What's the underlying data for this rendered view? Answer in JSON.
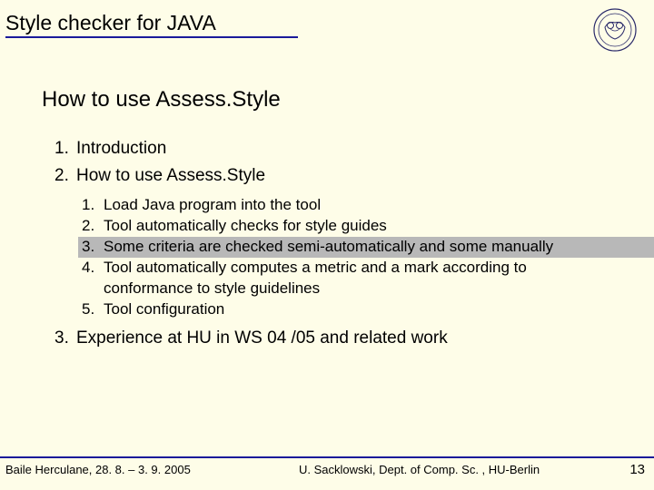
{
  "header": {
    "title": "Style checker for JAVA"
  },
  "section_title": "How to use Assess.Style",
  "level1": [
    {
      "num": "1.",
      "text": "Introduction"
    },
    {
      "num": "2.",
      "text": "How to use Assess.Style"
    }
  ],
  "level2": [
    {
      "num": "1.",
      "text": "Load Java program into the tool",
      "hl": false
    },
    {
      "num": "2.",
      "text": "Tool automatically checks for style guides",
      "hl": false
    },
    {
      "num": "3.",
      "text": "Some criteria are checked semi-automatically and some manually",
      "hl": true
    },
    {
      "num": "4.",
      "text": "Tool automatically computes a metric and a mark according to conformance to style guidelines",
      "hl": false
    },
    {
      "num": "5.",
      "text": "Tool configuration",
      "hl": false
    }
  ],
  "level1_after": [
    {
      "num": "3.",
      "text": "Experience at HU in WS 04 /05 and related work"
    }
  ],
  "footer": {
    "left": "Baile Herculane, 28. 8. – 3. 9. 2005",
    "center": "U. Sacklowski, Dept. of Comp. Sc. , HU-Berlin",
    "right": "13"
  }
}
